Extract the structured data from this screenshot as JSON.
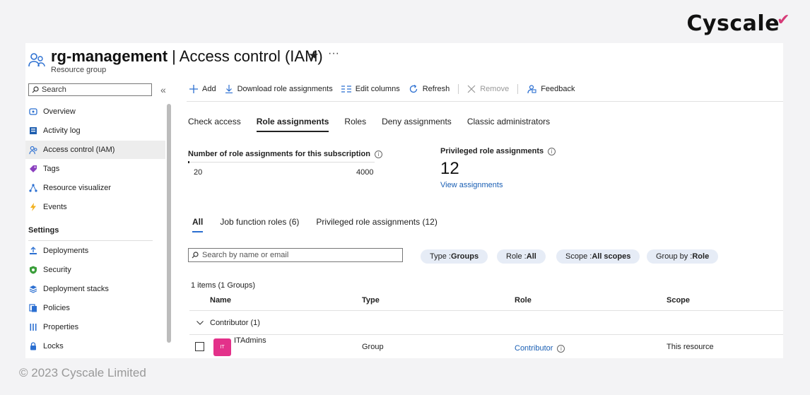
{
  "brand": {
    "name": "Cyscale"
  },
  "footer": {
    "copyright": "© 2023 Cyscale Limited"
  },
  "header": {
    "resource_name": "rg-management",
    "page_title": "| Access control (IAM)",
    "subtitle": "Resource group",
    "favorite_icon": "star-icon",
    "more_icon": "ellipsis-icon"
  },
  "sidebar": {
    "search_placeholder": "Search",
    "collapse": "«",
    "items": [
      {
        "label": "Overview",
        "icon": "overview-icon"
      },
      {
        "label": "Activity log",
        "icon": "activity-log-icon"
      },
      {
        "label": "Access control (IAM)",
        "icon": "people-icon",
        "active": true
      },
      {
        "label": "Tags",
        "icon": "tag-icon"
      },
      {
        "label": "Resource visualizer",
        "icon": "visualizer-icon"
      },
      {
        "label": "Events",
        "icon": "lightning-icon"
      }
    ],
    "settings_heading": "Settings",
    "settings_items": [
      {
        "label": "Deployments",
        "icon": "deploy-icon"
      },
      {
        "label": "Security",
        "icon": "shield-icon"
      },
      {
        "label": "Deployment stacks",
        "icon": "stack-icon"
      },
      {
        "label": "Policies",
        "icon": "policy-icon"
      },
      {
        "label": "Properties",
        "icon": "properties-icon"
      },
      {
        "label": "Locks",
        "icon": "lock-icon"
      }
    ]
  },
  "toolbar": {
    "add": "Add",
    "download": "Download role assignments",
    "edit_columns": "Edit columns",
    "refresh": "Refresh",
    "remove": "Remove",
    "feedback": "Feedback"
  },
  "tabs": [
    {
      "label": "Check access"
    },
    {
      "label": "Role assignments",
      "selected": true
    },
    {
      "label": "Roles"
    },
    {
      "label": "Deny assignments"
    },
    {
      "label": "Classic administrators"
    }
  ],
  "stats": {
    "count_label": "Number of role assignments for this subscription",
    "current": "20",
    "max": "4000",
    "used_fraction": 0.005,
    "privileged_label": "Privileged role assignments",
    "privileged_count": "12",
    "view_link": "View assignments"
  },
  "subtabs": [
    {
      "label": "All",
      "selected": true
    },
    {
      "label": "Job function roles (6)"
    },
    {
      "label": "Privileged role assignments (12)"
    }
  ],
  "filters": {
    "search_placeholder": "Search by name or email",
    "type_key": "Type : ",
    "type_val": "Groups",
    "role_key": "Role : ",
    "role_val": "All",
    "scope_key": "Scope : ",
    "scope_val": "All scopes",
    "group_key": "Group by : ",
    "group_val": "Role"
  },
  "table": {
    "summary": "1 items (1 Groups)",
    "columns": [
      "Name",
      "Type",
      "Role",
      "Scope"
    ],
    "group_label": "Contributor (1)",
    "rows": [
      {
        "initials": "IT",
        "name": "ITAdmins",
        "type": "Group",
        "role": "Contributor",
        "scope": "This resource"
      }
    ]
  },
  "colors": {
    "accent": "#1a5fb4",
    "avatar": "#e3318a",
    "pill_bg": "#e6ecf6",
    "brand_mark": "#d63b78"
  }
}
